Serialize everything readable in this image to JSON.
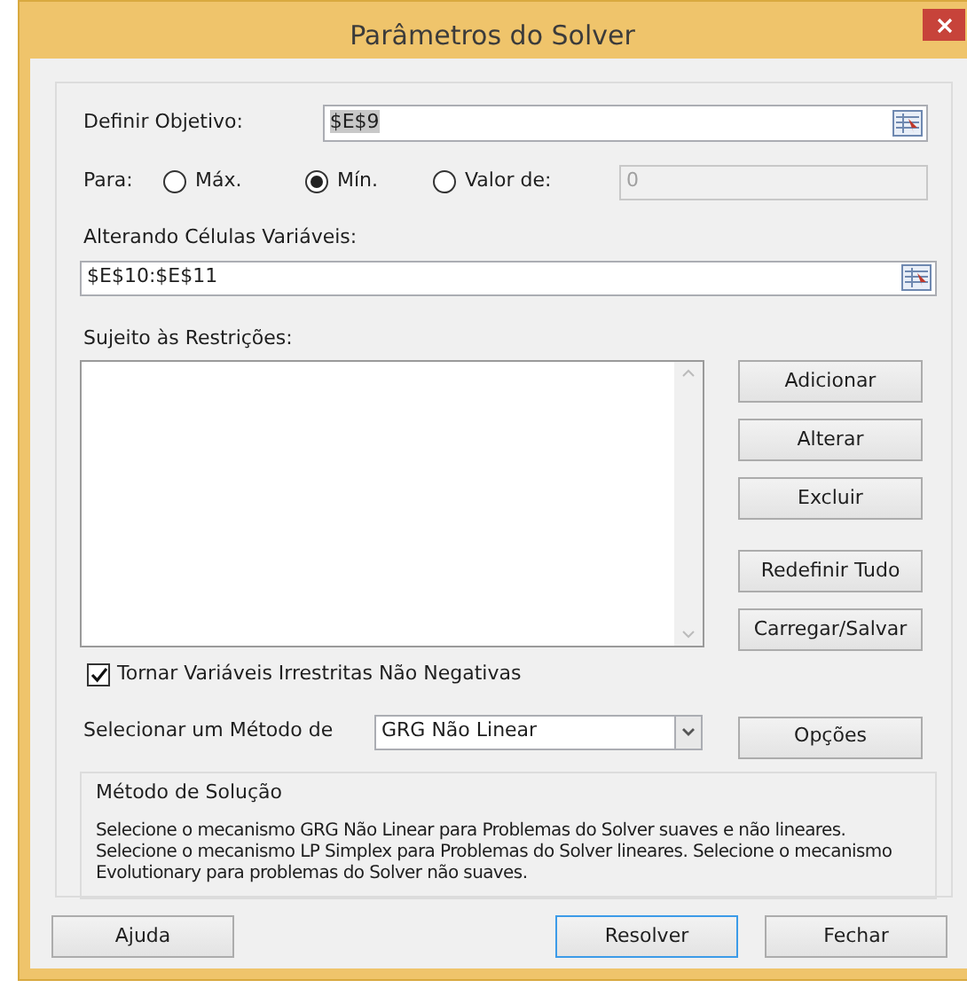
{
  "window": {
    "title": "Parâmetros do Solver"
  },
  "objective": {
    "label": "Definir Objetivo:",
    "value": "$E$9",
    "text_selected": true
  },
  "to": {
    "label": "Para:",
    "options": [
      {
        "label": "Máx.",
        "selected": false
      },
      {
        "label": "Mín.",
        "selected": true
      },
      {
        "label": "Valor de:",
        "selected": false
      }
    ],
    "value_field": {
      "value": "0",
      "disabled": true
    }
  },
  "changing_cells": {
    "label": "Alterando Células Variáveis:",
    "value": "$E$10:$E$11"
  },
  "constraints": {
    "label": "Sujeito às Restrições:",
    "buttons": [
      "Adicionar",
      "Alterar",
      "Excluir",
      "Redefinir Tudo",
      "Carregar/Salvar"
    ]
  },
  "nonnegative": {
    "label": "Tornar Variáveis Irrestritas Não Negativas",
    "checked": true
  },
  "method": {
    "label": "Selecionar um Método de",
    "value": "GRG Não Linear",
    "button": "Opções"
  },
  "method_info": {
    "title": "Método de Solução",
    "text": "Selecione o mecanismo GRG Não Linear para Problemas do Solver suaves e não lineares. Selecione o mecanismo LP Simplex para Problemas do Solver lineares. Selecione o mecanismo Evolutionary para problemas do Solver não suaves."
  },
  "buttons": [
    {
      "label": "Ajuda",
      "focused": false
    },
    {
      "label": "Resolver",
      "focused": true
    },
    {
      "label": "Fechar",
      "focused": false
    }
  ]
}
